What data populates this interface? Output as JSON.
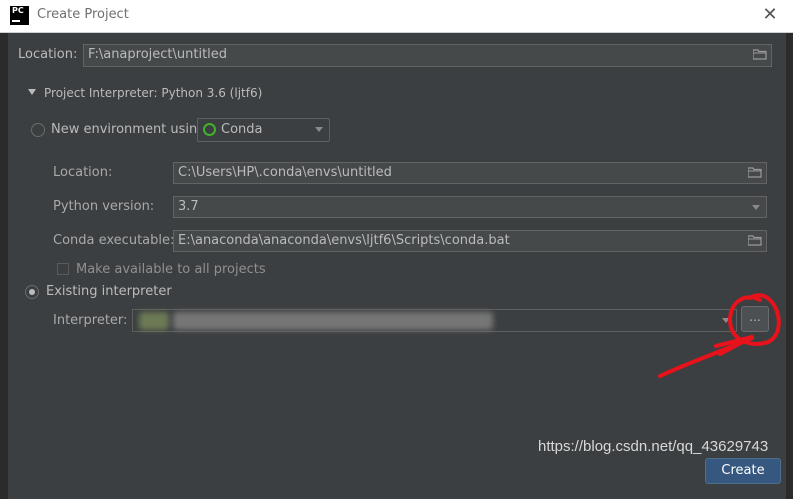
{
  "window": {
    "title": "Create Project",
    "app_icon_text": "PC",
    "close_symbol": "✕"
  },
  "location": {
    "label": "Location:",
    "value": "F:\\anaproject\\untitled",
    "icon": "folder-icon"
  },
  "interpreter_section": {
    "header": "Project Interpreter: Python 3.6 (ljtf6)",
    "expanded": true
  },
  "new_env": {
    "radio_label": "New environment using",
    "selected": false,
    "tool": "Conda",
    "location_label": "Location:",
    "location_value": "C:\\Users\\HP\\.conda\\envs\\untitled",
    "python_version_label": "Python version:",
    "python_version_value": "3.7",
    "conda_exe_label": "Conda executable:",
    "conda_exe_value": "E:\\anaconda\\anaconda\\envs\\ljtf6\\Scripts\\conda.bat",
    "make_available_label": "Make available to all projects",
    "make_available_checked": false
  },
  "existing": {
    "radio_label": "Existing interpreter",
    "selected": true,
    "interpreter_label": "Interpreter:",
    "browse_label": "..."
  },
  "footer": {
    "create_label": "Create"
  },
  "watermark": "https://blog.csdn.net/qq_43629743",
  "colors": {
    "dialog_bg": "#3c3f41",
    "field_bg": "#45494a",
    "create_button": "#365880",
    "annotation": "#e8121b",
    "conda_green": "#43b02a"
  }
}
